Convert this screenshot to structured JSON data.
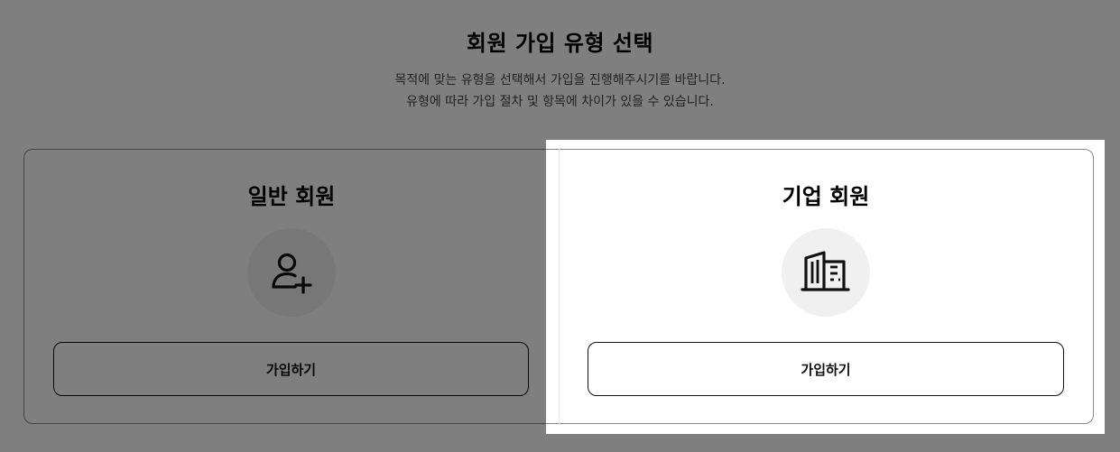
{
  "page": {
    "title": "회원 가입 유형 선택",
    "description_line1": "목적에 맞는 유형을 선택해서 가입을 진행해주시기를 바랍니다.",
    "description_line2": "유형에 따라 가입 절차 및 항목에 차이가 있을 수 있습니다."
  },
  "cards": [
    {
      "title": "일반 회원",
      "icon": "user-plus-icon",
      "button_label": "가입하기"
    },
    {
      "title": "기업 회원",
      "icon": "building-icon",
      "button_label": "가입하기"
    }
  ],
  "highlight": {
    "selected_card": "기업 회원",
    "dim_color": "#000000"
  }
}
